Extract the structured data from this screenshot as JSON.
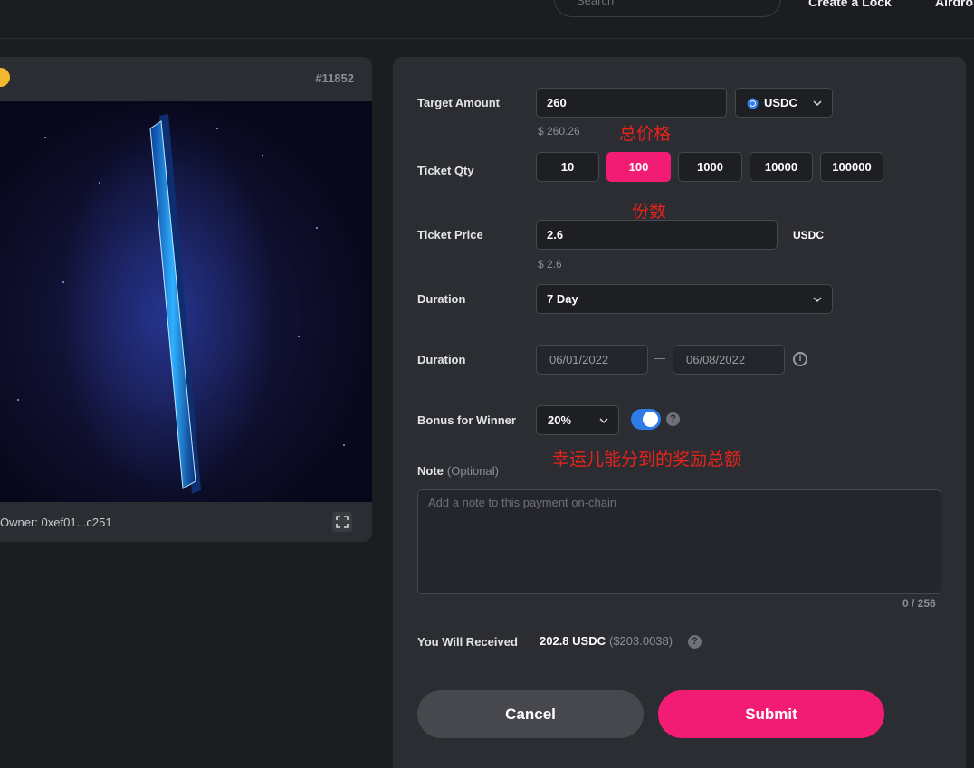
{
  "nav": {
    "search_placeholder": "Search",
    "link1": "Create a Lock",
    "link2": "Airdrop"
  },
  "nft": {
    "token_id": "#11852",
    "owner_label": "Owner:",
    "owner_value": "0xef01...c251"
  },
  "form": {
    "target_amount": {
      "label": "Target Amount",
      "value": "260",
      "currency": "USDC",
      "usd_value": "$ 260.26",
      "annotation": "总价格"
    },
    "ticket_qty": {
      "label": "Ticket Qty",
      "options": [
        "10",
        "100",
        "1000",
        "10000",
        "100000"
      ],
      "selected": "100",
      "annotation": "份数"
    },
    "ticket_price": {
      "label": "Ticket Price",
      "value": "2.6",
      "unit": "USDC",
      "usd_value": "$ 2.6"
    },
    "duration_select": {
      "label": "Duration",
      "value": "7 Day"
    },
    "duration_range": {
      "label": "Duration",
      "start": "06/01/2022",
      "separator": "—",
      "end": "06/08/2022"
    },
    "bonus": {
      "label": "Bonus for Winner",
      "value": "20%",
      "toggle_on": true,
      "annotation": "幸运儿能分到的奖励总额"
    },
    "note": {
      "label": "Note",
      "optional": "(Optional)",
      "placeholder": "Add a note to this payment on-chain",
      "counter": "0 / 256"
    },
    "received": {
      "label": "You Will Received",
      "value": "202.8 USDC",
      "usd": "($203.0038)"
    },
    "cancel_label": "Cancel",
    "submit_label": "Submit"
  },
  "colors": {
    "accent": "#f31c74",
    "toggle": "#2f7be8",
    "annotation": "#e8231b"
  }
}
